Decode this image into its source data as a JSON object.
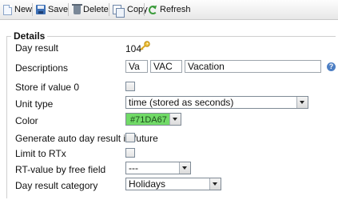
{
  "toolbar": {
    "new_label": "New",
    "save_label": "Save",
    "delete_label": "Delete",
    "copy_label": "Copy",
    "refresh_label": "Refresh"
  },
  "details": {
    "legend": "Details",
    "day_result": {
      "label": "Day result",
      "value": "104"
    },
    "descriptions": {
      "label": "Descriptions",
      "short": "Va",
      "code": "VAC",
      "long": "Vacation"
    },
    "store_if_zero": {
      "label": "Store if value 0",
      "checked": false
    },
    "unit_type": {
      "label": "Unit type",
      "value": "time (stored as seconds)"
    },
    "color": {
      "label": "Color",
      "value": "#71DA67",
      "swatch": "#71DA67"
    },
    "generate_future": {
      "label": "Generate auto day result in future",
      "checked": false
    },
    "limit_rtx": {
      "label": "Limit to RTx",
      "checked": false
    },
    "rt_value": {
      "label": "RT-value by free field",
      "value": "---"
    },
    "category": {
      "label": "Day result category",
      "value": "Holidays"
    }
  }
}
